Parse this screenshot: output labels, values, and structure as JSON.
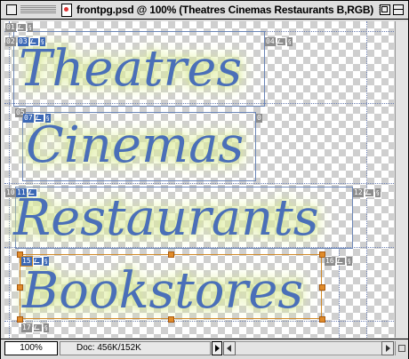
{
  "window": {
    "title": "frontpg.psd @ 100% (Theatres Cinemas Restaurants B,RGB)"
  },
  "artwork": {
    "words": [
      "Theatres",
      "Cinemas",
      "Restaurants",
      "Bookstores"
    ],
    "text_color": "#4a6fb8",
    "glow_color": "#d8e89a"
  },
  "slices": [
    {
      "number": "01",
      "kind": "auto",
      "icons": [
        "image-icon",
        "link-icon"
      ]
    },
    {
      "number": "02",
      "kind": "auto",
      "icons": []
    },
    {
      "number": "03",
      "kind": "user",
      "icons": [
        "image-icon",
        "link-icon"
      ]
    },
    {
      "number": "04",
      "kind": "auto",
      "icons": [
        "image-icon",
        "link-icon"
      ]
    },
    {
      "number": "05",
      "kind": "auto",
      "icons": []
    },
    {
      "number": "07",
      "kind": "user",
      "icons": [
        "image-icon",
        "link-icon"
      ]
    },
    {
      "number": "0",
      "kind": "auto",
      "icons": []
    },
    {
      "number": "10",
      "kind": "auto",
      "icons": []
    },
    {
      "number": "11",
      "kind": "user",
      "icons": [
        "image-icon"
      ]
    },
    {
      "number": "12",
      "kind": "auto",
      "icons": [
        "image-icon",
        "link-icon"
      ]
    },
    {
      "number": "15",
      "kind": "selected",
      "icons": [
        "image-icon",
        "link-icon"
      ]
    },
    {
      "number": "16",
      "kind": "auto",
      "icons": [
        "image-icon",
        "link-icon"
      ]
    },
    {
      "number": "17",
      "kind": "auto",
      "icons": [
        "image-icon",
        "link-icon"
      ]
    }
  ],
  "status": {
    "zoom": "100%",
    "doc_info": "Doc: 456K/152K"
  }
}
